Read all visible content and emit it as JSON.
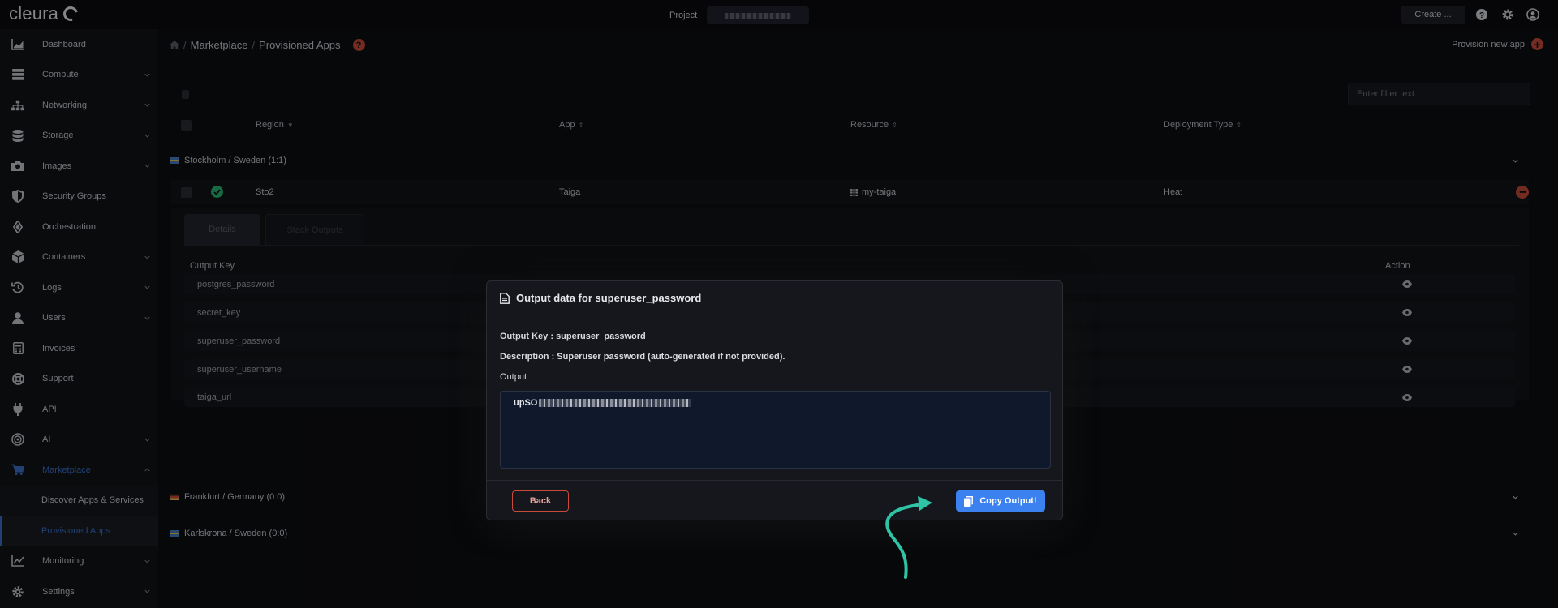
{
  "brand": {
    "name": "cleura"
  },
  "topbar": {
    "project_label": "Project",
    "create_label": "Create ..."
  },
  "sidebar": {
    "items": [
      {
        "label": "Dashboard",
        "icon": "chart-icon"
      },
      {
        "label": "Compute",
        "icon": "server-icon"
      },
      {
        "label": "Networking",
        "icon": "network-icon"
      },
      {
        "label": "Storage",
        "icon": "database-icon"
      },
      {
        "label": "Images",
        "icon": "camera-icon"
      },
      {
        "label": "Security Groups",
        "icon": "shield-icon"
      },
      {
        "label": "Orchestration",
        "icon": "orchestration-icon"
      },
      {
        "label": "Containers",
        "icon": "cube-icon"
      },
      {
        "label": "Logs",
        "icon": "history-icon"
      },
      {
        "label": "Users",
        "icon": "user-icon"
      },
      {
        "label": "Invoices",
        "icon": "calculator-icon"
      },
      {
        "label": "Support",
        "icon": "lifebuoy-icon"
      },
      {
        "label": "API",
        "icon": "plug-icon"
      },
      {
        "label": "AI",
        "icon": "ai-icon"
      },
      {
        "label": "Marketplace",
        "icon": "cart-icon"
      }
    ],
    "marketplace_sub": [
      "Discover Apps & Services",
      "Provisioned Apps"
    ],
    "bottom_items": [
      {
        "label": "Monitoring",
        "icon": "monitor-icon"
      },
      {
        "label": "Settings",
        "icon": "gear-icon"
      }
    ]
  },
  "breadcrumb": {
    "marketplace": "Marketplace",
    "current": "Provisioned Apps"
  },
  "provision_label": "Provision new app",
  "filter": {
    "placeholder": "Enter filter text..."
  },
  "table": {
    "headers": {
      "region": "Region",
      "app": "App",
      "resource": "Resource",
      "deployment": "Deployment Type"
    }
  },
  "regions": [
    {
      "label": "Stockholm / Sweden (1:1)"
    },
    {
      "label": "Frankfurt / Germany (0:0)"
    },
    {
      "label": "Karlskrona / Sweden (0:0)"
    }
  ],
  "app_row": {
    "region": "Sto2",
    "app": "Taiga",
    "resource": "my-taiga",
    "deployment": "Heat"
  },
  "tabs": {
    "details": "Details",
    "outputs": "Stack Outputs"
  },
  "outputs": {
    "key_header": "Output Key",
    "action_header": "Action",
    "rows": [
      "postgres_password",
      "secret_key",
      "superuser_password",
      "superuser_username",
      "taiga_url"
    ]
  },
  "modal": {
    "title": "Output data for superuser_password",
    "key_label": "Output Key : ",
    "key_value": "superuser_password",
    "desc_label": "Description : ",
    "desc_value": "Superuser password (auto-generated if not provided).",
    "output_label": "Output",
    "output_prefix": "upSO",
    "back_label": "Back",
    "copy_label": "Copy Output!"
  },
  "colors": {
    "accent_red": "#c94a3a",
    "primary_blue": "#3b82f0",
    "active_nav": "#3b6fc7",
    "success_green": "#2bb673",
    "arrow_teal": "#2ec4a5"
  }
}
